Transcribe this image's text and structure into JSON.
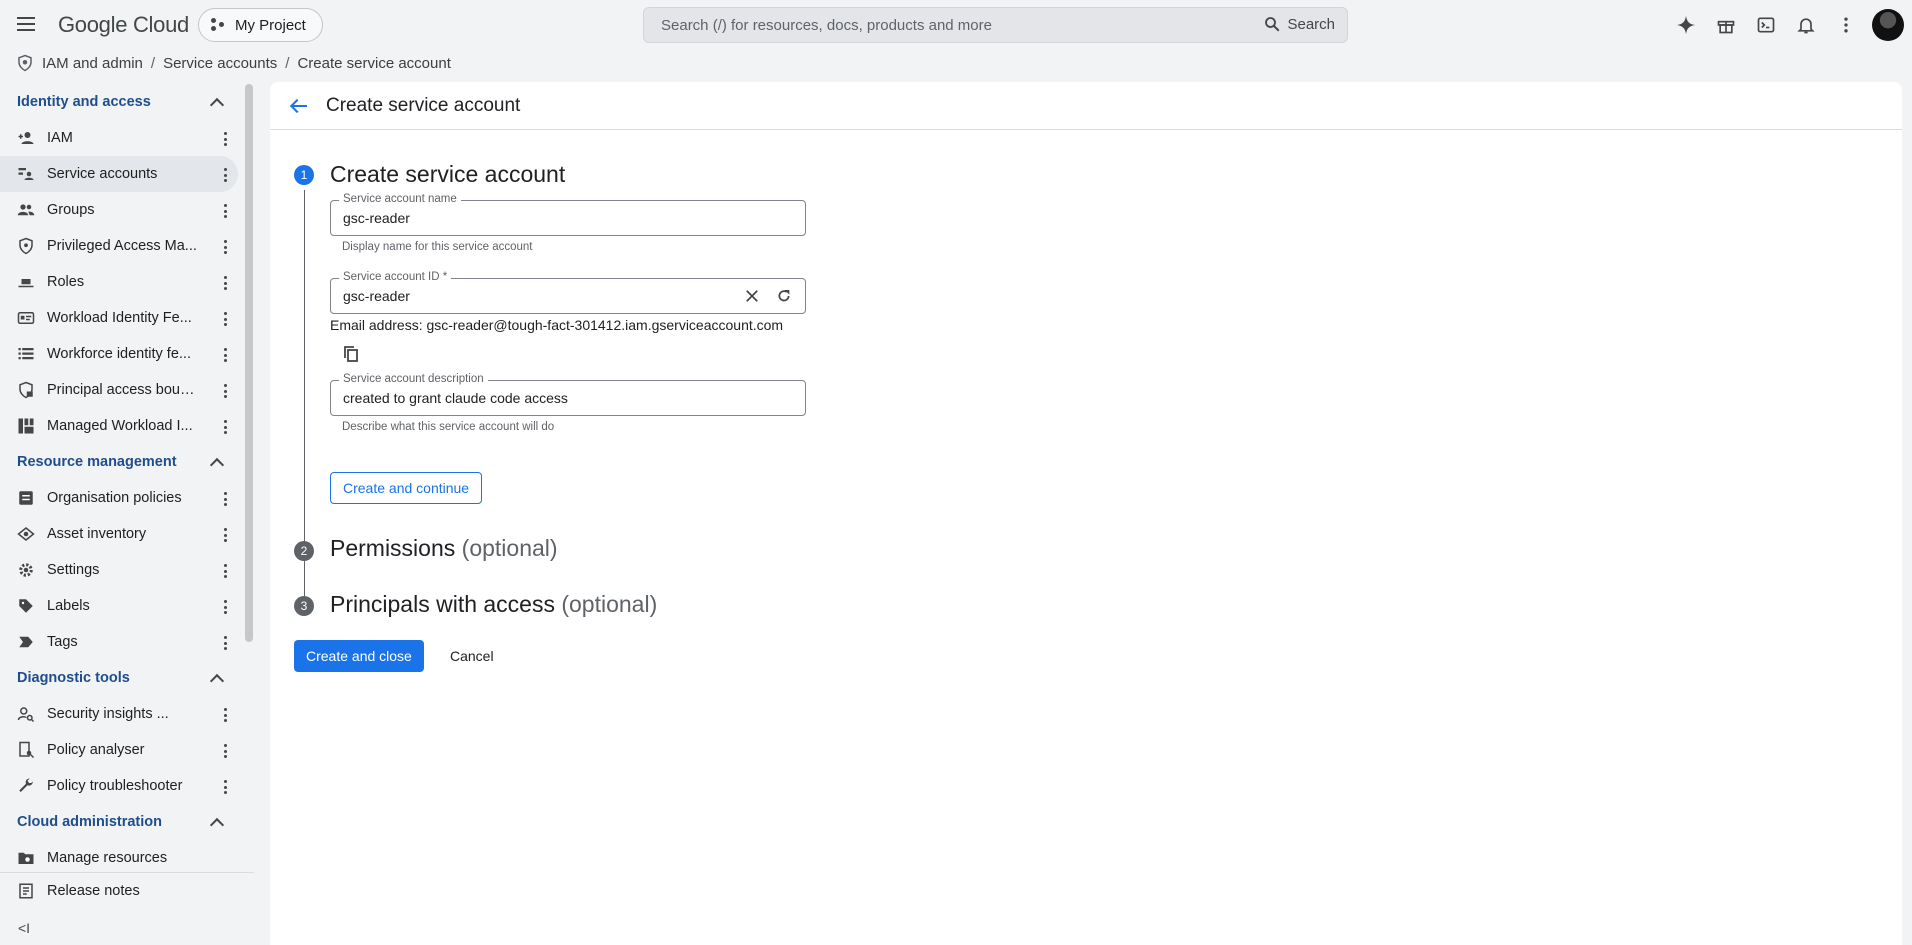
{
  "app": {
    "logo": "Google Cloud",
    "project": "My Project"
  },
  "search": {
    "placeholder": "Search (/) for resources, docs, products and more",
    "button": "Search"
  },
  "breadcrumb": {
    "items": [
      "IAM and admin",
      "Service accounts",
      "Create service account"
    ],
    "separator": "/"
  },
  "sidebar": {
    "sections": [
      {
        "title": "Identity and access",
        "items": [
          {
            "label": "IAM",
            "icon": "add-person-icon"
          },
          {
            "label": "Service accounts",
            "icon": "service-account-icon",
            "active": true
          },
          {
            "label": "Groups",
            "icon": "groups-icon"
          },
          {
            "label": "Privileged Access Ma...",
            "icon": "shield-icon"
          },
          {
            "label": "Roles",
            "icon": "roles-hat-icon"
          },
          {
            "label": "Workload Identity Fe...",
            "icon": "id-card-icon"
          },
          {
            "label": "Workforce identity fe...",
            "icon": "list-icon"
          },
          {
            "label": "Principal access boun...",
            "icon": "shield-lock-icon"
          },
          {
            "label": "Managed Workload I...",
            "icon": "grid-icon"
          }
        ]
      },
      {
        "title": "Resource management",
        "items": [
          {
            "label": "Organisation policies",
            "icon": "document-icon"
          },
          {
            "label": "Asset inventory",
            "icon": "layers-icon"
          },
          {
            "label": "Settings",
            "icon": "gear-icon"
          },
          {
            "label": "Labels",
            "icon": "label-tag-icon"
          },
          {
            "label": "Tags",
            "icon": "tag-chevron-icon"
          }
        ]
      },
      {
        "title": "Diagnostic tools",
        "items": [
          {
            "label": "Security insights ...",
            "icon": "person-search-icon"
          },
          {
            "label": "Policy analyser",
            "icon": "policy-search-icon"
          },
          {
            "label": "Policy troubleshooter",
            "icon": "wrench-icon"
          }
        ]
      },
      {
        "title": "Cloud administration",
        "items": [
          {
            "label": "Manage resources",
            "icon": "folder-gear-icon"
          }
        ]
      }
    ],
    "bottom": {
      "release_notes": "Release notes",
      "collapse": "<I"
    }
  },
  "main": {
    "title": "Create service account",
    "steps": [
      {
        "number": "1",
        "title": "Create service account",
        "optional": ""
      },
      {
        "number": "2",
        "title": "Permissions",
        "optional": "(optional)"
      },
      {
        "number": "3",
        "title": "Principals with access",
        "optional": "(optional)"
      }
    ],
    "form": {
      "name_label": "Service account name",
      "name_value": "gsc-reader",
      "name_hint": "Display name for this service account",
      "id_label": "Service account ID *",
      "id_value": "gsc-reader",
      "email": "Email address: gsc-reader@tough-fact-301412.iam.gserviceaccount.com",
      "desc_label": "Service account description",
      "desc_value": "created to grant claude code access",
      "desc_hint": "Describe what this service account will do",
      "continue_button": "Create and continue"
    },
    "actions": {
      "create_close": "Create and close",
      "cancel": "Cancel"
    }
  }
}
